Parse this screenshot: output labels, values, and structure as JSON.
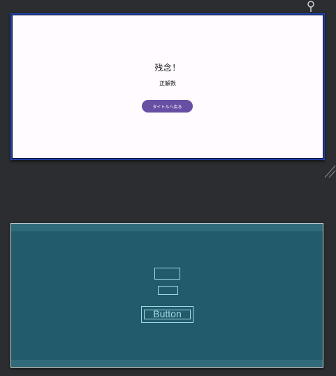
{
  "design": {
    "title": "残念！",
    "subtitle": "正解数",
    "back_button": "タイトルへ戻る",
    "background_color": "#fffbfe",
    "button_color": "#6750a4",
    "selection_color": "#1f3fae"
  },
  "blueprint": {
    "button_label": "Button",
    "background_color": "#225b6b",
    "outline_color": "#9fd9e6"
  },
  "icons": {
    "pin": "pin-icon",
    "resize": "resize-handle-icon"
  }
}
